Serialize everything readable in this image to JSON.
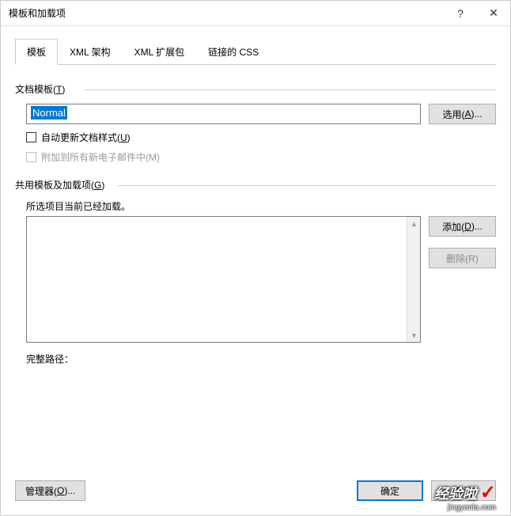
{
  "titlebar": {
    "title": "模板和加载项",
    "help": "?",
    "close": "✕"
  },
  "tabs": {
    "items": [
      {
        "label": "模板"
      },
      {
        "label": "XML 架构"
      },
      {
        "label": "XML 扩展包"
      },
      {
        "label": "链接的 CSS"
      }
    ]
  },
  "doc_template": {
    "title_prefix": "文档模板(",
    "title_key": "T",
    "title_suffix": ")",
    "value": "Normal",
    "select_btn_prefix": "选用(",
    "select_btn_key": "A",
    "select_btn_suffix": ")...",
    "auto_update_prefix": "自动更新文档样式(",
    "auto_update_key": "U",
    "auto_update_suffix": ")",
    "attach_email": "附加到所有新电子邮件中(M)"
  },
  "shared": {
    "title_prefix": "共用模板及加载项(",
    "title_key": "G",
    "title_suffix": ")",
    "loaded_text": "所选项目当前已经加载。",
    "add_btn_prefix": "添加(",
    "add_btn_key": "D",
    "add_btn_suffix": ")...",
    "remove_btn": "删除(R)",
    "fullpath_label": "完整路径："
  },
  "footer": {
    "manager_prefix": "管理器(",
    "manager_key": "O",
    "manager_suffix": ")...",
    "ok": "确定",
    "cancel": "取消"
  },
  "watermark": {
    "text": "经验啦",
    "sub": "jingyanla.com"
  }
}
